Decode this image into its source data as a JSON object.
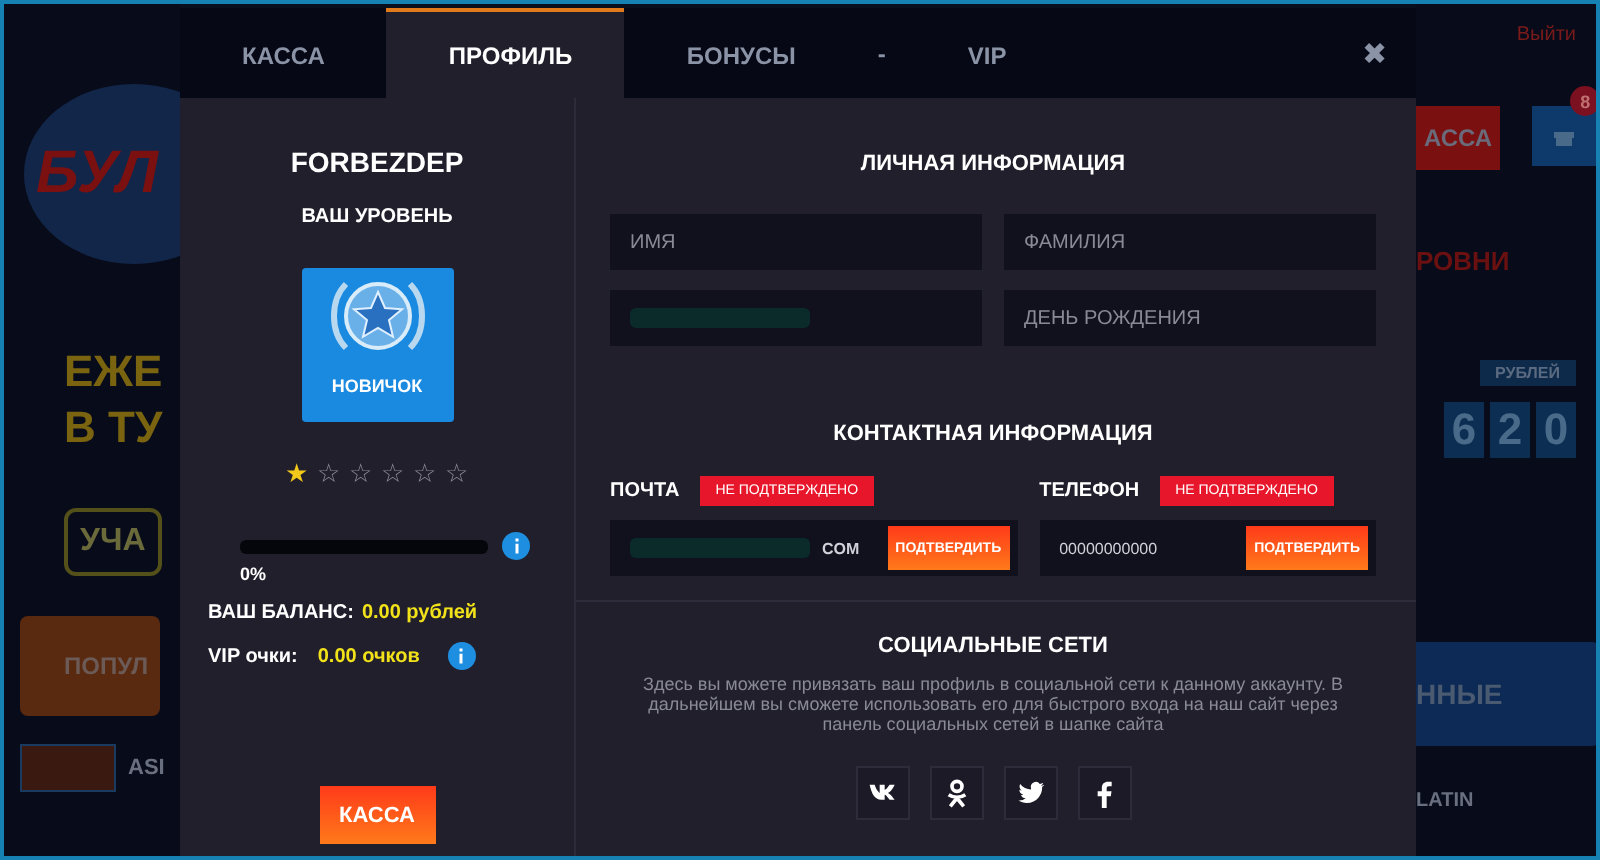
{
  "backdrop_left": {
    "logo_text": "БУЛ",
    "promo_line_1": "ЕЖЕ",
    "promo_line_2": "В ТУ",
    "join_button": "УЧА",
    "popular_tab": "ПОПУЛ",
    "game_label": "ASI"
  },
  "backdrop_right": {
    "logout_link": "Выйти",
    "cashier_button": "АССА",
    "gift_badge": "8",
    "levels_heading": "РОВНИ",
    "currency_label": "РУБЛЕЙ",
    "jackpot_digits": [
      "6",
      "2",
      "0"
    ],
    "new_tab": "ННЫЕ",
    "game_label": "LATIN"
  },
  "modal": {
    "tabs": [
      {
        "kind": "tab",
        "label": "КАССА",
        "selected": false
      },
      {
        "kind": "tab",
        "label": "ПРОФИЛЬ",
        "selected": true
      },
      {
        "kind": "tab",
        "label": "БОНУСЫ",
        "selected": false
      },
      {
        "kind": "separator",
        "label": "-"
      },
      {
        "kind": "tab",
        "label": "VIP",
        "selected": false
      }
    ],
    "close": "✖",
    "profile": {
      "username": "FORBEZDEP",
      "level_heading": "ВАШ УРОВЕНЬ",
      "level_name": "НОВИЧОК",
      "stars": 1,
      "progress": {
        "level": 0,
        "reading": "0%"
      },
      "balance": {
        "label": "ВАШ БАЛАНС:",
        "value": "0.00 рублей"
      },
      "vip_points": {
        "label": "VIP очки:",
        "value": "0.00 очков"
      },
      "cashier_button": "КАССА"
    },
    "personal_info": {
      "heading": "ЛИЧНАЯ ИНФОРМАЦИЯ",
      "fields": [
        {
          "kind": "placeholder",
          "placeholder": "ИМЯ"
        },
        {
          "kind": "placeholder",
          "placeholder": "ФАМИЛИЯ"
        },
        {
          "kind": "redacted"
        },
        {
          "kind": "placeholder",
          "placeholder": "ДЕНЬ РОЖДЕНИЯ"
        }
      ]
    },
    "contact_info": {
      "heading": "КОНТАКТНАЯ ИНФОРМАЦИЯ",
      "items": [
        {
          "label": "ПОЧТА",
          "status": "НЕ ПОДТВЕРЖДЕНО",
          "value": "COM",
          "redacted": true,
          "button": "ПОДТВЕРДИТЬ"
        },
        {
          "label": "ТЕЛЕФОН",
          "status": "НЕ ПОДТВЕРЖДЕНО",
          "value": "00000000000",
          "redacted": false,
          "button": "ПОДТВЕРДИТЬ"
        }
      ]
    },
    "social": {
      "heading": "СОЦИАЛЬНЫЕ СЕТИ",
      "text": "Здесь вы можете привязать ваш профиль в социальной сети к данному аккаунту. В дальнейшем вы сможете использовать его для быстрого входа на наш сайт через панель социальных сетей в шапке сайта",
      "buttons": [
        {
          "kind": "vk"
        },
        {
          "kind": "ok"
        },
        {
          "kind": "twitter"
        },
        {
          "kind": "facebook"
        }
      ]
    }
  }
}
